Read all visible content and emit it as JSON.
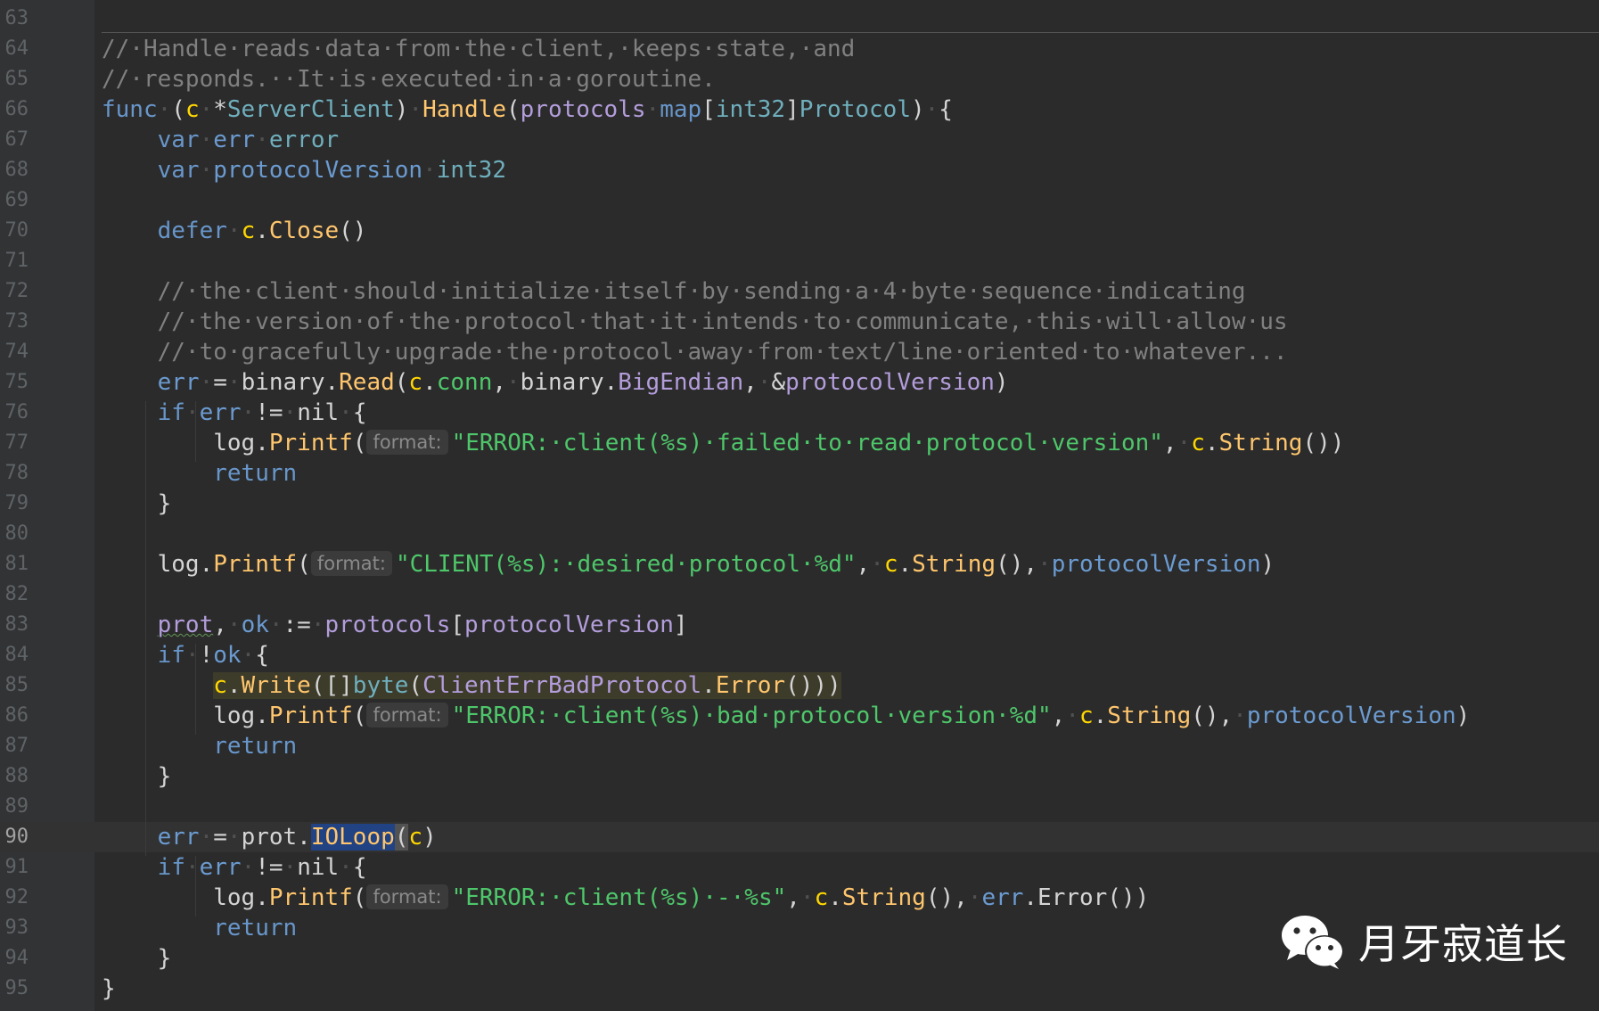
{
  "editor": {
    "lines": [
      {
        "n": "63",
        "tokens": []
      },
      {
        "n": "64",
        "tokens": [
          {
            "c": "t-comment",
            "t": "//·Handle·reads·data·from·the·client,·keeps·state,·and"
          }
        ]
      },
      {
        "n": "65",
        "tokens": [
          {
            "c": "t-comment",
            "t": "//·responds.··It·is·executed·in·a·goroutine."
          }
        ]
      },
      {
        "n": "66",
        "tokens": [
          {
            "c": "t-kw",
            "t": "func"
          },
          {
            "c": "t-ws",
            "t": "·"
          },
          {
            "c": "t-plain",
            "t": "("
          },
          {
            "c": "t-param",
            "t": "c"
          },
          {
            "c": "t-ws",
            "t": "·"
          },
          {
            "c": "t-plain",
            "t": "*"
          },
          {
            "c": "t-type",
            "t": "ServerClient"
          },
          {
            "c": "t-plain",
            "t": ")"
          },
          {
            "c": "t-ws",
            "t": "·"
          },
          {
            "c": "t-fn",
            "t": "Handle"
          },
          {
            "c": "t-plain",
            "t": "("
          },
          {
            "c": "t-proto",
            "t": "protocols"
          },
          {
            "c": "t-ws",
            "t": "·"
          },
          {
            "c": "t-kw",
            "t": "map"
          },
          {
            "c": "t-plain",
            "t": "["
          },
          {
            "c": "t-type",
            "t": "int32"
          },
          {
            "c": "t-plain",
            "t": "]"
          },
          {
            "c": "t-type",
            "t": "Protocol"
          },
          {
            "c": "t-plain",
            "t": ")"
          },
          {
            "c": "t-ws",
            "t": "·"
          },
          {
            "c": "t-plain",
            "t": "{"
          }
        ]
      },
      {
        "n": "67",
        "tokens": [
          {
            "c": "t-ws",
            "t": "    "
          },
          {
            "c": "t-kw",
            "t": "var"
          },
          {
            "c": "t-ws",
            "t": "·"
          },
          {
            "c": "t-blue",
            "t": "err"
          },
          {
            "c": "t-ws",
            "t": "·"
          },
          {
            "c": "t-type",
            "t": "error"
          }
        ]
      },
      {
        "n": "68",
        "tokens": [
          {
            "c": "t-ws",
            "t": "    "
          },
          {
            "c": "t-kw",
            "t": "var"
          },
          {
            "c": "t-ws",
            "t": "·"
          },
          {
            "c": "t-blue",
            "t": "protocolVersion"
          },
          {
            "c": "t-ws",
            "t": "·"
          },
          {
            "c": "t-type",
            "t": "int32"
          }
        ]
      },
      {
        "n": "69",
        "tokens": []
      },
      {
        "n": "70",
        "tokens": [
          {
            "c": "t-ws",
            "t": "    "
          },
          {
            "c": "t-kw",
            "t": "defer"
          },
          {
            "c": "t-ws",
            "t": "·"
          },
          {
            "c": "t-param",
            "t": "c"
          },
          {
            "c": "t-plain",
            "t": "."
          },
          {
            "c": "t-fn",
            "t": "Close"
          },
          {
            "c": "t-plain",
            "t": "()"
          }
        ]
      },
      {
        "n": "71",
        "tokens": []
      },
      {
        "n": "72",
        "tokens": [
          {
            "c": "t-ws",
            "t": "    "
          },
          {
            "c": "t-comment",
            "t": "//·the·client·should·initialize·itself·by·sending·a·4·byte·sequence·indicating"
          }
        ]
      },
      {
        "n": "73",
        "tokens": [
          {
            "c": "t-ws",
            "t": "    "
          },
          {
            "c": "t-comment",
            "t": "//·the·version·of·the·protocol·that·it·intends·to·communicate,·this·will·allow·us"
          }
        ]
      },
      {
        "n": "74",
        "tokens": [
          {
            "c": "t-ws",
            "t": "    "
          },
          {
            "c": "t-comment",
            "t": "//·to·gracefully·upgrade·the·protocol·away·from·text/line·oriented·to·whatever..."
          }
        ]
      },
      {
        "n": "75",
        "tokens": [
          {
            "c": "t-ws",
            "t": "    "
          },
          {
            "c": "t-blue",
            "t": "err"
          },
          {
            "c": "t-ws",
            "t": "·"
          },
          {
            "c": "t-plain",
            "t": "="
          },
          {
            "c": "t-ws",
            "t": "·"
          },
          {
            "c": "t-plain",
            "t": "binary."
          },
          {
            "c": "t-fn",
            "t": "Read"
          },
          {
            "c": "t-plain",
            "t": "("
          },
          {
            "c": "t-param",
            "t": "c"
          },
          {
            "c": "t-plain",
            "t": "."
          },
          {
            "c": "t-green",
            "t": "conn"
          },
          {
            "c": "t-plain",
            "t": ","
          },
          {
            "c": "t-ws",
            "t": "·"
          },
          {
            "c": "t-plain",
            "t": "binary."
          },
          {
            "c": "t-proto",
            "t": "BigEndian"
          },
          {
            "c": "t-plain",
            "t": ","
          },
          {
            "c": "t-ws",
            "t": "·"
          },
          {
            "c": "t-plain",
            "t": "&"
          },
          {
            "c": "t-proto",
            "t": "protocolVersion"
          },
          {
            "c": "t-plain",
            "t": ")"
          }
        ]
      },
      {
        "n": "76",
        "tokens": [
          {
            "c": "t-ws",
            "t": "    "
          },
          {
            "c": "t-kw",
            "t": "if"
          },
          {
            "c": "t-ws",
            "t": "·"
          },
          {
            "c": "t-blue",
            "t": "err"
          },
          {
            "c": "t-ws",
            "t": "·"
          },
          {
            "c": "t-plain",
            "t": "!="
          },
          {
            "c": "t-ws",
            "t": "·"
          },
          {
            "c": "t-plain",
            "t": "nil"
          },
          {
            "c": "t-ws",
            "t": "·"
          },
          {
            "c": "t-plain",
            "t": "{"
          }
        ]
      },
      {
        "n": "77",
        "tokens": [
          {
            "c": "t-ws",
            "t": "        "
          },
          {
            "c": "t-plain",
            "t": "log."
          },
          {
            "c": "t-fn",
            "t": "Printf"
          },
          {
            "c": "t-plain",
            "t": "("
          },
          {
            "c": "hint",
            "t": "format:"
          },
          {
            "c": "t-green",
            "t": "\"ERROR:·client(%s)·failed·to·read·protocol·version\""
          },
          {
            "c": "t-plain",
            "t": ","
          },
          {
            "c": "t-ws",
            "t": "·"
          },
          {
            "c": "t-param",
            "t": "c"
          },
          {
            "c": "t-plain",
            "t": "."
          },
          {
            "c": "t-fn",
            "t": "String"
          },
          {
            "c": "t-plain",
            "t": "())"
          }
        ]
      },
      {
        "n": "78",
        "tokens": [
          {
            "c": "t-ws",
            "t": "        "
          },
          {
            "c": "t-kw",
            "t": "return"
          }
        ]
      },
      {
        "n": "79",
        "tokens": [
          {
            "c": "t-ws",
            "t": "    "
          },
          {
            "c": "t-plain",
            "t": "}"
          }
        ]
      },
      {
        "n": "80",
        "tokens": []
      },
      {
        "n": "81",
        "tokens": [
          {
            "c": "t-ws",
            "t": "    "
          },
          {
            "c": "t-plain",
            "t": "log."
          },
          {
            "c": "t-fn",
            "t": "Printf"
          },
          {
            "c": "t-plain",
            "t": "("
          },
          {
            "c": "hint",
            "t": "format:"
          },
          {
            "c": "t-green",
            "t": "\"CLIENT(%s):·desired·protocol·%d\""
          },
          {
            "c": "t-plain",
            "t": ","
          },
          {
            "c": "t-ws",
            "t": "·"
          },
          {
            "c": "t-param",
            "t": "c"
          },
          {
            "c": "t-plain",
            "t": "."
          },
          {
            "c": "t-fn",
            "t": "String"
          },
          {
            "c": "t-plain",
            "t": "(),"
          },
          {
            "c": "t-ws",
            "t": "·"
          },
          {
            "c": "t-blue",
            "t": "protocolVersion"
          },
          {
            "c": "t-plain",
            "t": ")"
          }
        ]
      },
      {
        "n": "82",
        "tokens": []
      },
      {
        "n": "83",
        "tokens": [
          {
            "c": "t-ws",
            "t": "    "
          },
          {
            "c": "t-proto squiggle",
            "t": "prot"
          },
          {
            "c": "t-plain",
            "t": ","
          },
          {
            "c": "t-ws",
            "t": "·"
          },
          {
            "c": "t-blue",
            "t": "ok"
          },
          {
            "c": "t-ws",
            "t": "·"
          },
          {
            "c": "t-plain",
            "t": ":="
          },
          {
            "c": "t-ws",
            "t": "·"
          },
          {
            "c": "t-proto",
            "t": "protocols"
          },
          {
            "c": "t-plain",
            "t": "["
          },
          {
            "c": "t-proto",
            "t": "protocolVersion"
          },
          {
            "c": "t-plain",
            "t": "]"
          }
        ]
      },
      {
        "n": "84",
        "tokens": [
          {
            "c": "t-ws",
            "t": "    "
          },
          {
            "c": "t-kw",
            "t": "if"
          },
          {
            "c": "t-ws",
            "t": "·"
          },
          {
            "c": "t-plain",
            "t": "!"
          },
          {
            "c": "t-blue",
            "t": "ok"
          },
          {
            "c": "t-ws",
            "t": "·"
          },
          {
            "c": "t-plain",
            "t": "{"
          }
        ]
      },
      {
        "n": "85",
        "tokens": [
          {
            "c": "t-ws",
            "t": "        "
          },
          {
            "c": "hl-line t-param",
            "t": "c"
          },
          {
            "c": "hl-line t-plain",
            "t": "."
          },
          {
            "c": "hl-line t-fn",
            "t": "Write"
          },
          {
            "c": "hl-line t-plain",
            "t": "([]"
          },
          {
            "c": "hl-line t-type",
            "t": "byte"
          },
          {
            "c": "hl-line t-plain",
            "t": "("
          },
          {
            "c": "hl-line t-proto",
            "t": "ClientErrBadProtocol"
          },
          {
            "c": "hl-line t-plain",
            "t": "."
          },
          {
            "c": "hl-line t-fn",
            "t": "Error"
          },
          {
            "c": "hl-line t-plain",
            "t": "()))"
          }
        ]
      },
      {
        "n": "86",
        "tokens": [
          {
            "c": "t-ws",
            "t": "        "
          },
          {
            "c": "t-plain",
            "t": "log."
          },
          {
            "c": "t-fn",
            "t": "Printf"
          },
          {
            "c": "t-plain",
            "t": "("
          },
          {
            "c": "hint",
            "t": "format:"
          },
          {
            "c": "t-green",
            "t": "\"ERROR:·client(%s)·bad·protocol·version·%d\""
          },
          {
            "c": "t-plain",
            "t": ","
          },
          {
            "c": "t-ws",
            "t": "·"
          },
          {
            "c": "t-param",
            "t": "c"
          },
          {
            "c": "t-plain",
            "t": "."
          },
          {
            "c": "t-fn",
            "t": "String"
          },
          {
            "c": "t-plain",
            "t": "(),"
          },
          {
            "c": "t-ws",
            "t": "·"
          },
          {
            "c": "t-blue",
            "t": "protocolVersion"
          },
          {
            "c": "t-plain",
            "t": ")"
          }
        ]
      },
      {
        "n": "87",
        "tokens": [
          {
            "c": "t-ws",
            "t": "        "
          },
          {
            "c": "t-kw",
            "t": "return"
          }
        ]
      },
      {
        "n": "88",
        "tokens": [
          {
            "c": "t-ws",
            "t": "    "
          },
          {
            "c": "t-plain",
            "t": "}"
          }
        ]
      },
      {
        "n": "89",
        "tokens": []
      },
      {
        "n": "90",
        "current": true,
        "tokens": [
          {
            "c": "t-ws",
            "t": "    "
          },
          {
            "c": "t-blue",
            "t": "err"
          },
          {
            "c": "t-ws",
            "t": "·"
          },
          {
            "c": "t-plain",
            "t": "="
          },
          {
            "c": "t-ws",
            "t": "·"
          },
          {
            "c": "t-plain",
            "t": "prot."
          },
          {
            "c": "sel t-fn",
            "t": "IOLoop"
          },
          {
            "c": "caret-box t-plain",
            "t": "("
          },
          {
            "c": "t-param",
            "t": "c"
          },
          {
            "c": "t-plain",
            "t": ")"
          }
        ]
      },
      {
        "n": "91",
        "tokens": [
          {
            "c": "t-ws",
            "t": "    "
          },
          {
            "c": "t-kw",
            "t": "if"
          },
          {
            "c": "t-ws",
            "t": "·"
          },
          {
            "c": "t-blue",
            "t": "err"
          },
          {
            "c": "t-ws",
            "t": "·"
          },
          {
            "c": "t-plain",
            "t": "!="
          },
          {
            "c": "t-ws",
            "t": "·"
          },
          {
            "c": "t-plain",
            "t": "nil"
          },
          {
            "c": "t-ws",
            "t": "·"
          },
          {
            "c": "t-plain",
            "t": "{"
          }
        ]
      },
      {
        "n": "92",
        "tokens": [
          {
            "c": "t-ws",
            "t": "        "
          },
          {
            "c": "t-plain",
            "t": "log."
          },
          {
            "c": "t-fn",
            "t": "Printf"
          },
          {
            "c": "t-plain",
            "t": "("
          },
          {
            "c": "hint",
            "t": "format:"
          },
          {
            "c": "t-green",
            "t": "\"ERROR:·client(%s)·-·%s\""
          },
          {
            "c": "t-plain",
            "t": ","
          },
          {
            "c": "t-ws",
            "t": "·"
          },
          {
            "c": "t-param",
            "t": "c"
          },
          {
            "c": "t-plain",
            "t": "."
          },
          {
            "c": "t-fn",
            "t": "String"
          },
          {
            "c": "t-plain",
            "t": "(),"
          },
          {
            "c": "t-ws",
            "t": "·"
          },
          {
            "c": "t-blue",
            "t": "err"
          },
          {
            "c": "t-plain",
            "t": ".Error())"
          }
        ]
      },
      {
        "n": "93",
        "tokens": [
          {
            "c": "t-ws",
            "t": "        "
          },
          {
            "c": "t-kw",
            "t": "return"
          }
        ]
      },
      {
        "n": "94",
        "tokens": [
          {
            "c": "t-ws",
            "t": "    "
          },
          {
            "c": "t-plain",
            "t": "}"
          }
        ]
      },
      {
        "n": "95",
        "tokens": [
          {
            "c": "t-plain",
            "t": "}"
          }
        ]
      }
    ]
  },
  "watermark": {
    "icon": "wechat-icon",
    "text": "月牙寂道长"
  }
}
